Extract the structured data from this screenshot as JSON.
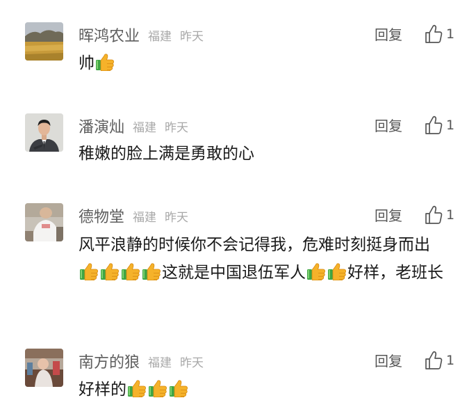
{
  "comments": [
    {
      "name": "晖鸿农业",
      "location": "福建",
      "time": "昨天",
      "reply_label": "回复",
      "like_count": "1",
      "text_parts": [
        "帅",
        "thumbs-up-emoji"
      ]
    },
    {
      "name": "潘演灿",
      "location": "福建",
      "time": "昨天",
      "reply_label": "回复",
      "like_count": "1",
      "text_parts": [
        "稚嫩的脸上满是勇敢的心"
      ]
    },
    {
      "name": "德物堂",
      "location": "福建",
      "time": "昨天",
      "reply_label": "回复",
      "like_count": "1",
      "text_parts": [
        "风平浪静的时候你不会记得我，危难时刻挺身而出",
        "thumbs-up-emoji",
        "thumbs-up-emoji",
        "thumbs-up-emoji",
        "thumbs-up-emoji",
        "这就是中国退伍军人",
        "thumbs-up-emoji",
        "thumbs-up-emoji",
        "好样，老班长"
      ]
    },
    {
      "name": "南方的狼",
      "location": "福建",
      "time": "昨天",
      "reply_label": "回复",
      "like_count": "1",
      "text_parts": [
        "好样的",
        "thumbs-up-emoji",
        "thumbs-up-emoji",
        "thumbs-up-emoji"
      ]
    }
  ],
  "icons": {
    "like": "thumbs-up-outline-icon",
    "emoji": "thumbs-up-emoji"
  },
  "colors": {
    "name": "#5d5d5d",
    "meta": "#a8a8a8",
    "text": "#1a1a1a",
    "action": "#555555",
    "emoji_hand": "#f5b22a",
    "emoji_cuff": "#3fa544"
  }
}
